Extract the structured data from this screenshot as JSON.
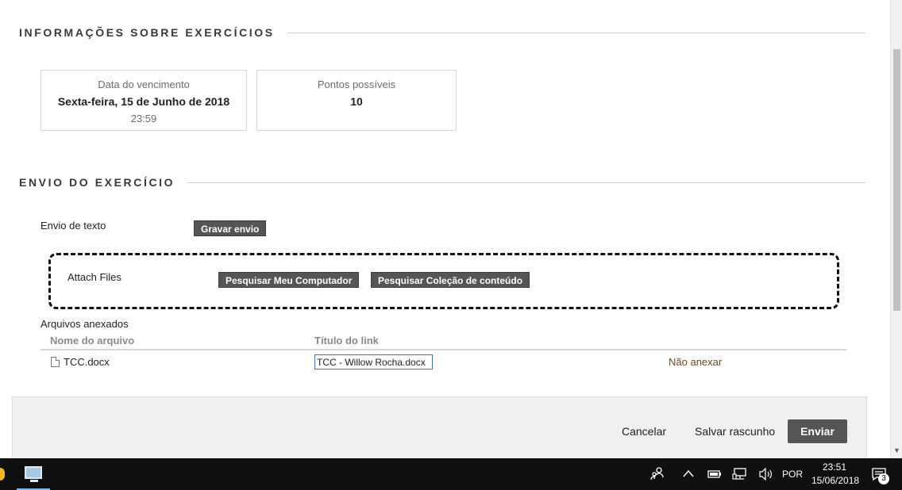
{
  "sections": {
    "info_title": "INFORMAÇÕES SOBRE EXERCÍCIOS",
    "submission_title": "ENVIO DO EXERCÍCIO"
  },
  "due_card": {
    "label": "Data do vencimento",
    "date": "Sexta-feira, 15 de Junho de 2018",
    "time": "23:59"
  },
  "points_card": {
    "label": "Pontos possíveis",
    "value": "10"
  },
  "text_submission": {
    "label": "Envio de texto",
    "button": "Gravar envio"
  },
  "attach": {
    "label": "Attach Files",
    "browse_computer": "Pesquisar Meu Computador",
    "browse_collection": "Pesquisar Coleção de conteúdo"
  },
  "attached_files": {
    "title": "Arquivos anexados",
    "columns": [
      "Nome do arquivo",
      "Título do link"
    ],
    "rows": [
      {
        "file_name": "TCC.docx",
        "link_title": "TCC - Willow Rocha.docx",
        "action": "Não anexar"
      }
    ]
  },
  "footer": {
    "cancel": "Cancelar",
    "save_draft": "Salvar rascunho",
    "submit": "Enviar"
  },
  "taskbar": {
    "language": "POR",
    "time": "23:51",
    "date": "15/06/2018",
    "notification_count": "3",
    "icons": [
      "people-icon",
      "chevron-up-icon",
      "battery-icon",
      "network-icon",
      "volume-icon",
      "notifications-icon"
    ]
  },
  "colors": {
    "button_dark": "#555555",
    "link_brown": "#6b4a24",
    "heading": "#3d3833",
    "accent_blue": "#3f73b5"
  }
}
